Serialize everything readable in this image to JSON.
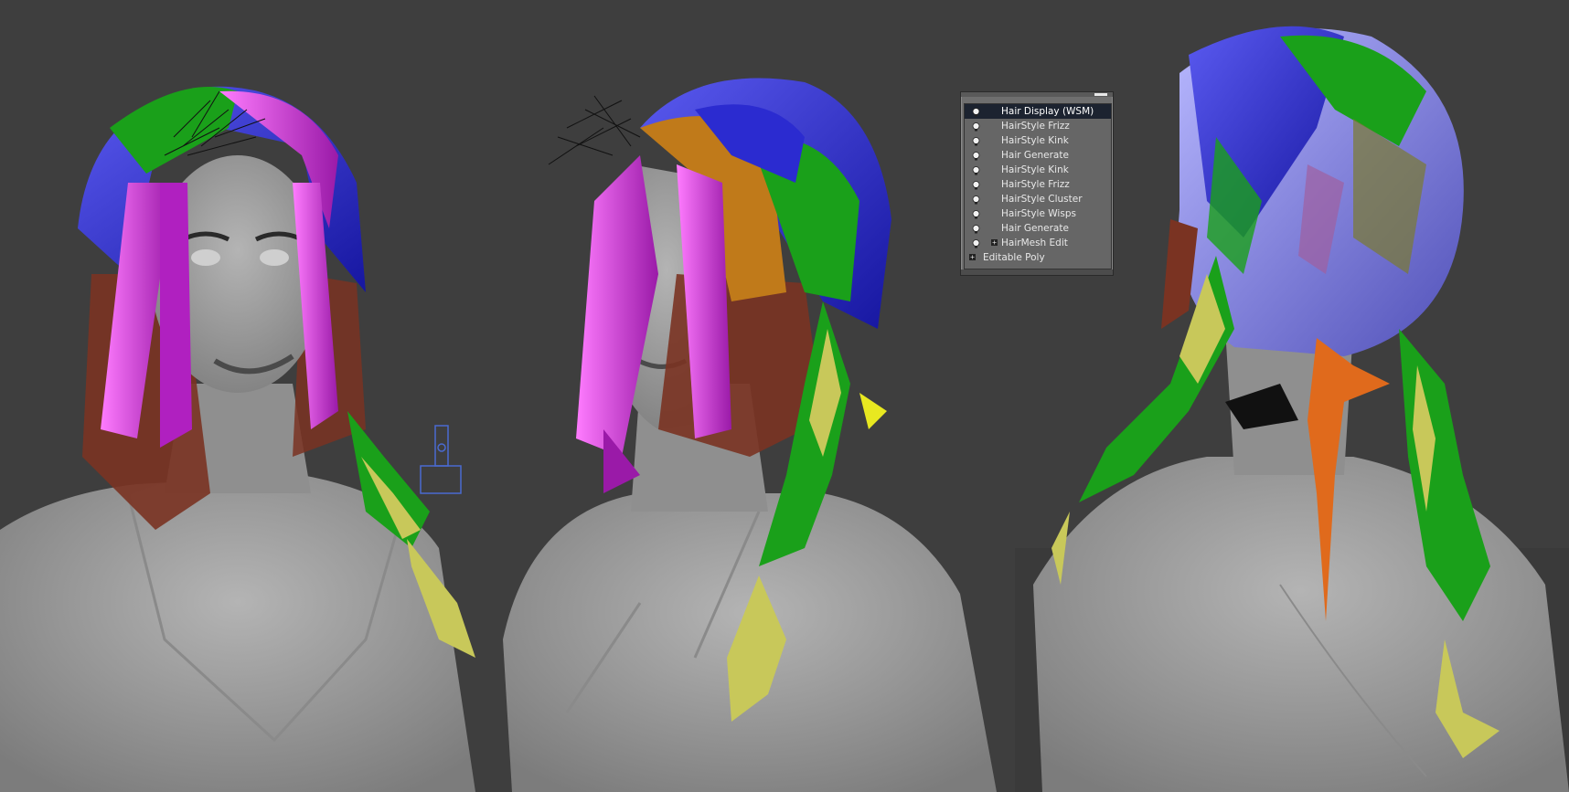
{
  "modifier_stack": {
    "items": [
      {
        "label": "Hair Display (WSM)",
        "selected": true,
        "has_bulb": true,
        "expandable": false
      },
      {
        "label": "HairStyle Frizz",
        "selected": false,
        "has_bulb": true,
        "expandable": false
      },
      {
        "label": "HairStyle Kink",
        "selected": false,
        "has_bulb": true,
        "expandable": false
      },
      {
        "label": "Hair Generate",
        "selected": false,
        "has_bulb": true,
        "expandable": false
      },
      {
        "label": "HairStyle Kink",
        "selected": false,
        "has_bulb": true,
        "expandable": false
      },
      {
        "label": "HairStyle Frizz",
        "selected": false,
        "has_bulb": true,
        "expandable": false
      },
      {
        "label": "HairStyle Cluster",
        "selected": false,
        "has_bulb": true,
        "expandable": false
      },
      {
        "label": "HairStyle Wisps",
        "selected": false,
        "has_bulb": true,
        "expandable": false
      },
      {
        "label": "Hair Generate",
        "selected": false,
        "has_bulb": true,
        "expandable": false
      },
      {
        "label": "HairMesh Edit",
        "selected": false,
        "has_bulb": true,
        "expandable": true
      },
      {
        "label": "Editable Poly",
        "selected": false,
        "has_bulb": false,
        "expandable": true
      }
    ]
  },
  "colors": {
    "viewport_bg": "#3e3e3e",
    "skin": "#9a9a9a",
    "hair_blue": "#2b2bd0",
    "hair_magenta": "#d23ad8",
    "hair_green": "#1aa01a",
    "hair_yellow": "#c8c85a",
    "hair_brown": "#7a3322",
    "hair_orange": "#e06a1c",
    "hair_lavender": "#8a8ae0",
    "helper_blue": "#4a6ad0"
  },
  "icons": {
    "visibility": "lightbulb-icon",
    "expand": "plus-box-icon",
    "helper": "hair-helper-gizmo-icon"
  }
}
